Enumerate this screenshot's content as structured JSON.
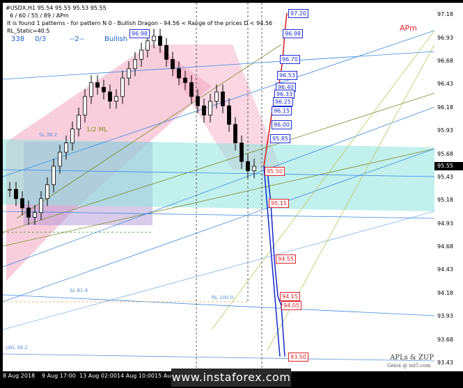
{
  "info": {
    "line1": "#USDX,H1  95.54 95.55 95.53 95.55",
    "line2": "6 / 60 / 55 / 89 / APm",
    "line3": "It is found 1 patterns  -  for pattern N 0 - Bullish Dragon - 94.56 < Range of the prices D < 94.56",
    "line4": "RL_Static=40.5",
    "counters": [
      "338",
      "0/3",
      "--2--",
      "Bullish"
    ]
  },
  "labels": {
    "apm": "APm",
    "signature_line1": "APLs & ZUP",
    "signature_line2": "Gelox @ mt5.com",
    "half_ml": "1/2 ML",
    "watermark": "www.instaforex.com"
  },
  "level_labels": [
    "SL 38.2",
    "SL 61.8",
    "RL 100.0",
    "LWL 38.2"
  ],
  "price_tags": [
    {
      "text": "96.98",
      "color": "blue"
    },
    {
      "text": "97.20",
      "color": "blue"
    },
    {
      "text": "96.98",
      "color": "blue"
    },
    {
      "text": "96.70",
      "color": "blue"
    },
    {
      "text": "96.53",
      "color": "blue"
    },
    {
      "text": "96.40",
      "color": "blue"
    },
    {
      "text": "96.33",
      "color": "blue"
    },
    {
      "text": "96.25",
      "color": "blue"
    },
    {
      "text": "96.15",
      "color": "blue"
    },
    {
      "text": "96.00",
      "color": "blue"
    },
    {
      "text": "95.85",
      "color": "blue"
    },
    {
      "text": "95.50",
      "color": "red"
    },
    {
      "text": "95.15",
      "color": "red"
    },
    {
      "text": "94.55",
      "color": "red"
    },
    {
      "text": "94.15",
      "color": "red"
    },
    {
      "text": "94.05",
      "color": "red"
    },
    {
      "text": "93.50",
      "color": "red"
    }
  ],
  "y_axis": {
    "ticks": [
      "97.18",
      "96.93",
      "96.68",
      "96.43",
      "96.18",
      "95.93",
      "95.68",
      "95.43",
      "95.18",
      "94.93",
      "94.68",
      "94.43",
      "94.18",
      "93.93",
      "93.68",
      "93.43"
    ],
    "current": "95.55"
  },
  "x_axis": {
    "ticks": [
      "8 Aug 2018",
      "9 Aug 17:00",
      "13 Aug 02:00",
      "14 Aug 10:00",
      "15 Aug"
    ]
  },
  "chart_data": {
    "type": "candlestick",
    "symbol": "#USDX",
    "timeframe": "H1",
    "ylim": [
      93.43,
      97.25
    ],
    "current_price": 95.55,
    "pattern": "Bullish Dragon",
    "candles_approx_close": [
      95.3,
      95.2,
      95.1,
      95.0,
      95.05,
      95.2,
      95.35,
      95.55,
      95.7,
      95.8,
      95.95,
      96.1,
      96.3,
      96.45,
      96.4,
      96.35,
      96.25,
      96.3,
      96.5,
      96.6,
      96.7,
      96.8,
      96.9,
      96.95,
      96.85,
      96.7,
      96.6,
      96.5,
      96.45,
      96.3,
      96.2,
      96.1,
      96.25,
      96.35,
      96.2,
      96.0,
      95.8,
      95.6,
      95.5,
      95.55
    ],
    "projection_blue": [
      97.2,
      96.98,
      96.7,
      96.53,
      96.4,
      96.33,
      96.25,
      96.15,
      96.0,
      95.85
    ],
    "projection_red": [
      95.5,
      95.15,
      94.55,
      94.15,
      94.05,
      93.5
    ]
  }
}
